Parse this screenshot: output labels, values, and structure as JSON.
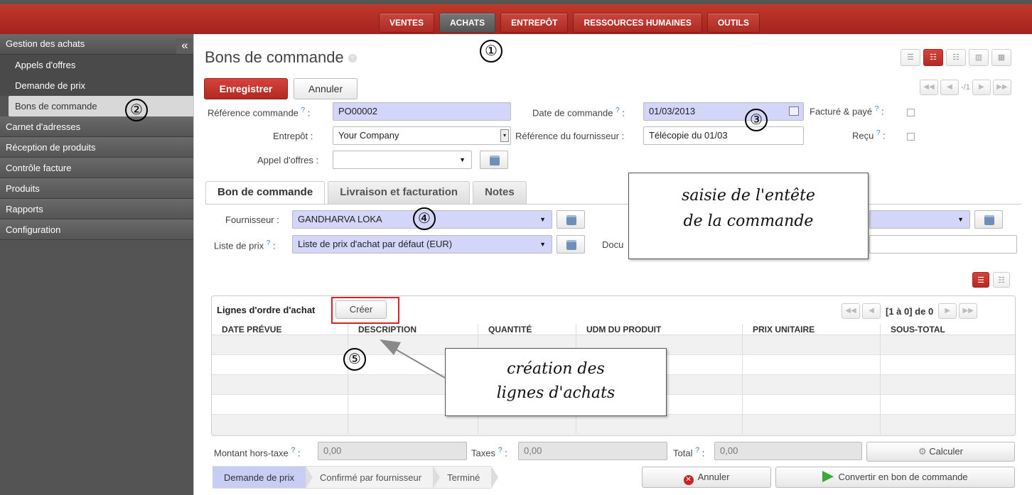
{
  "topmenu": [
    "VENTES",
    "ACHATS",
    "ENTREPÔT",
    "RESSOURCES HUMAINES",
    "OUTILS"
  ],
  "sidebar": {
    "header": "Gestion des achats",
    "collapse": "«",
    "subitems": [
      "Appels d'offres",
      "Demande de prix",
      "Bons de commande"
    ],
    "items": [
      "Carnet d'adresses",
      "Réception de produits",
      "Contrôle facture",
      "Produits",
      "Rapports",
      "Configuration"
    ]
  },
  "page": {
    "title": "Bons de commande",
    "help": "?",
    "pager": "-/1"
  },
  "toolbar": {
    "save": "Enregistrer",
    "cancel": "Annuler"
  },
  "form": {
    "ref_label": "Référence commande",
    "ref_value": "PO00002",
    "date_label": "Date de commande",
    "date_value": "01/03/2013",
    "invoiced_label": "Facturé & payé",
    "warehouse_label": "Entrepôt :",
    "warehouse_value": "Your Company",
    "supplier_ref_label": "Référence du fournisseur :",
    "supplier_ref_value": "Télécopie du 01/03",
    "received_label": "Reçu",
    "tender_label": "Appel d'offres :",
    "supplier_label": "Fournisseur :",
    "supplier_value": "GANDHARVA LOKA",
    "pricelist_label": "Liste de prix",
    "pricelist_value": "Liste de prix d'achat par défaut (EUR)",
    "doc_label": "Docu",
    "q": "?"
  },
  "tabs": [
    "Bon de commande",
    "Livraison et facturation",
    "Notes"
  ],
  "lines": {
    "title": "Lignes d'ordre d'achat",
    "create": "Créer",
    "pager": "[1 à 0] de 0",
    "columns": [
      "DATE PRÉVUE",
      "DESCRIPTION",
      "QUANTITÉ",
      "UDM DU PRODUIT",
      "PRIX UNITAIRE",
      "SOUS-TOTAL"
    ]
  },
  "totals": {
    "untaxed_label": "Montant hors-taxe",
    "untaxed_value": "0,00",
    "tax_label": "Taxes",
    "tax_value": "0,00",
    "total_label": "Total",
    "total_value": "0,00",
    "calc": "Calculer"
  },
  "status": [
    "Demande de prix",
    "Confirmé par fournisseur",
    "Terminé"
  ],
  "actions": {
    "cancel": "Annuler",
    "convert": "Convertir en bon de commande"
  },
  "annotations": {
    "n1": "①",
    "n2": "②",
    "n3": "③",
    "n4": "④",
    "n5": "⑤",
    "note1": "saisie de l'entête\nde la commande",
    "note2": "création des\nlignes d'achats"
  },
  "colors": {
    "brand": "#b02a23",
    "required": "#d3d6f8",
    "sidebar": "#545454"
  }
}
